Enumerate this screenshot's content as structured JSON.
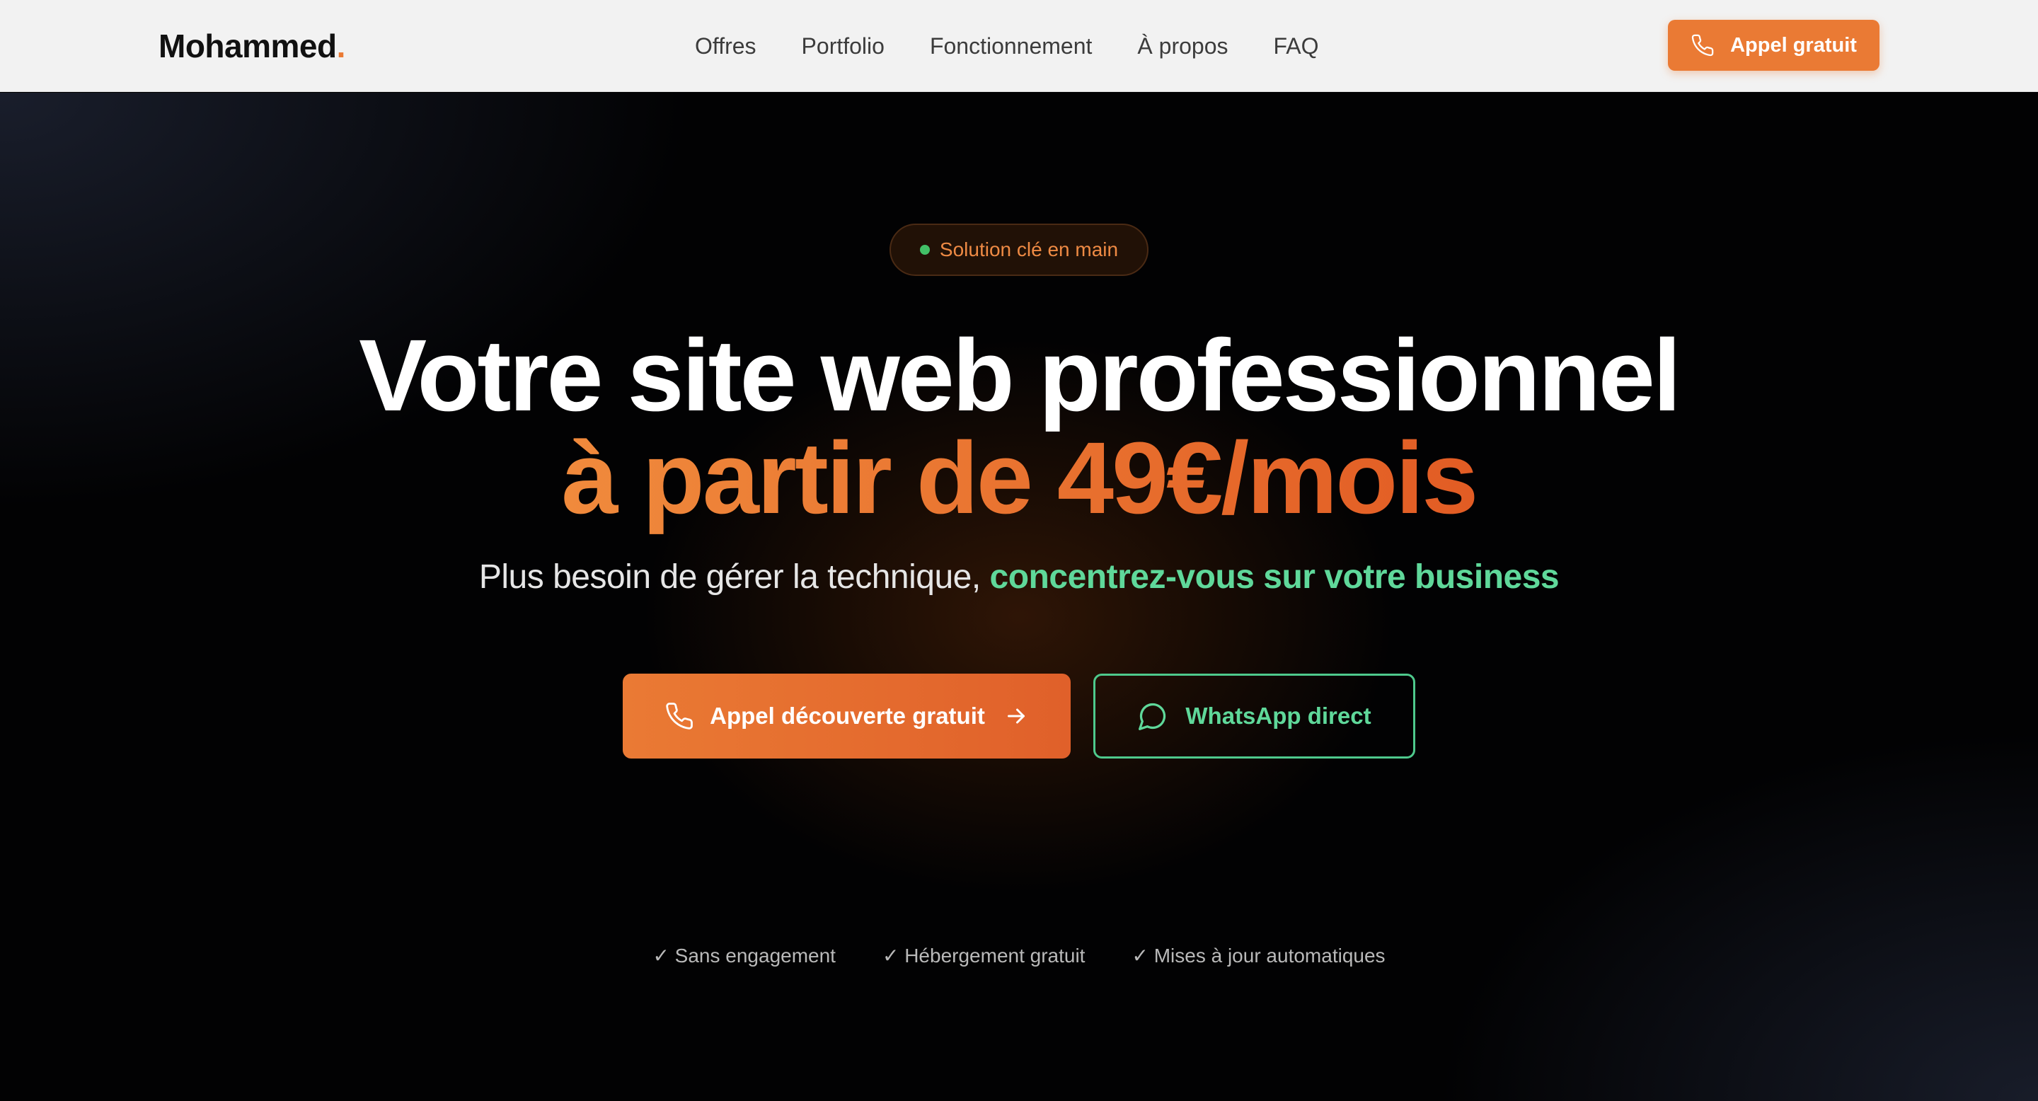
{
  "header": {
    "logo_text": "Mohammed",
    "logo_dot": ".",
    "nav": [
      "Offres",
      "Portfolio",
      "Fonctionnement",
      "À propos",
      "FAQ"
    ],
    "cta_label": "Appel gratuit",
    "cta_icon": "phone-icon"
  },
  "hero": {
    "badge": "Solution clé en main",
    "title_line1": "Votre site web professionnel",
    "title_line2": "à partir de 49€/mois",
    "subtitle_plain": "Plus besoin de gérer la technique, ",
    "subtitle_highlight": "concentrez-vous sur votre business",
    "primary_button": "Appel découverte gratuit",
    "secondary_button": "WhatsApp direct",
    "perks": [
      "✓ Sans engagement",
      "✓ Hébergement gratuit",
      "✓ Mises à jour automatiques"
    ]
  },
  "colors": {
    "accent": "#ea7a34",
    "green": "#5fd89a",
    "status_dot": "#42c067",
    "background": "#020203"
  }
}
